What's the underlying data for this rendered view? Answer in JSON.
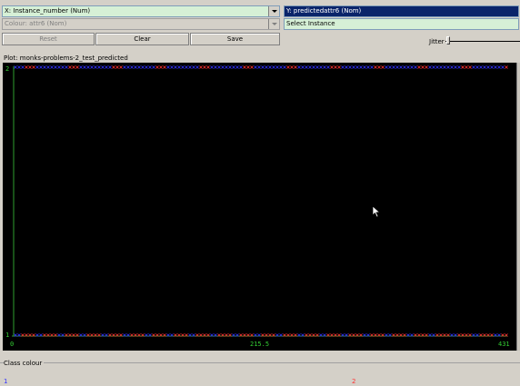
{
  "x_axis_combo": {
    "value": "X: Instance_number (Num)"
  },
  "y_axis_combo": {
    "value": "Y: predictedattr6 (Nom)"
  },
  "colour_combo": {
    "value": "Colour: attr6 (Nom)"
  },
  "select_instance_combo": {
    "value": "Select Instance"
  },
  "buttons": {
    "reset": "Reset",
    "clear": "Clear",
    "save": "Save"
  },
  "jitter_label": "Jitter",
  "plot": {
    "title": "Plot: monks-problems-2_test_predicted",
    "y_top_label": "2",
    "y_bottom_label": "1",
    "x_ticks": [
      "0",
      "215.5",
      "431"
    ]
  },
  "class_colour": {
    "legend_label": "Class colour",
    "classes": [
      {
        "label": "1",
        "color": "#3333ff"
      },
      {
        "label": "2",
        "color": "#ff3333"
      }
    ]
  },
  "chart_data": {
    "type": "scatter",
    "title": "Plot: monks-problems-2_test_predicted",
    "xlabel": "Instance_number",
    "ylabel": "predictedattr6",
    "xlim": [
      0,
      431
    ],
    "y_categories": [
      "1",
      "2"
    ],
    "x_ticks": [
      "0",
      "215.5",
      "431"
    ],
    "series": [
      {
        "name": "1",
        "color": "#3333ff"
      },
      {
        "name": "2",
        "color": "#ff3333"
      }
    ],
    "grid": false
  }
}
